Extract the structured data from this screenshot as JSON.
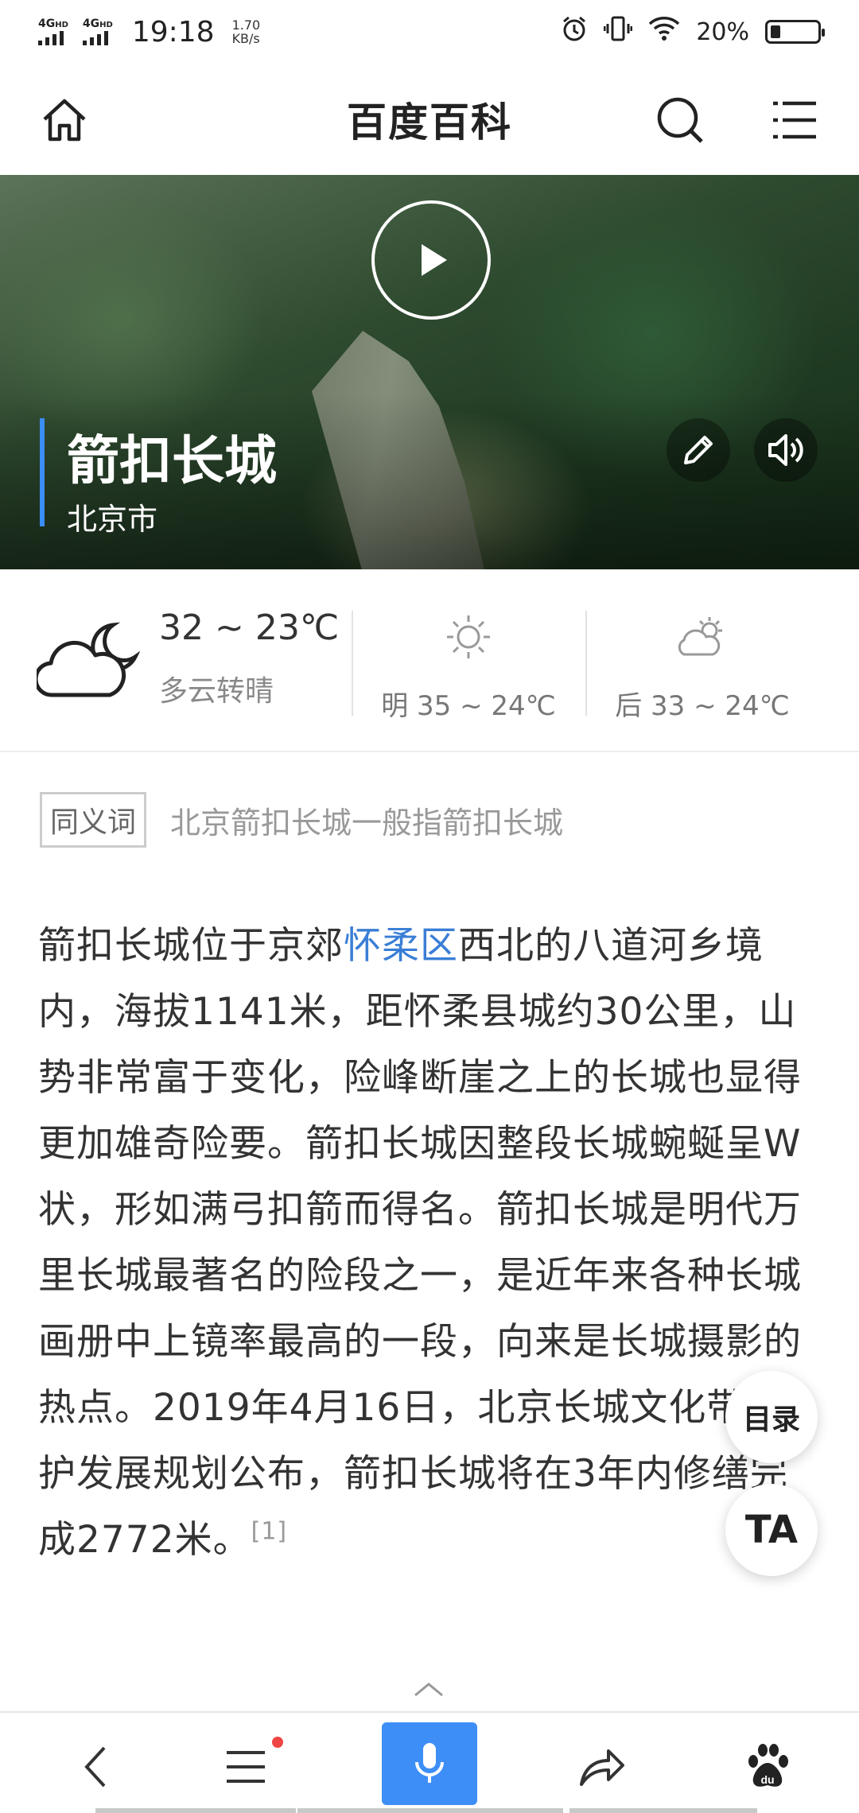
{
  "status_bar": {
    "network_1": "4G",
    "network_1_sup": "HD",
    "network_2": "4G",
    "network_2_sup": "HD",
    "time": "19:18",
    "speed_value": "1.70",
    "speed_unit": "KB/s",
    "battery_text": "20%",
    "battery_level": 0.2
  },
  "header": {
    "title": "百度百科",
    "home_icon": "home-icon",
    "search_icon": "search-icon",
    "menu_icon": "menu-list-icon"
  },
  "hero": {
    "title": "箭扣长城",
    "subtitle": "北京市",
    "accent_color": "#3a8ef6"
  },
  "weather": {
    "today": {
      "temp": "32 ~ 23℃",
      "desc": "多云转晴",
      "icon": "cloudy-night-icon"
    },
    "tomorrow": {
      "text": "明 35 ~ 24℃",
      "icon": "sun-icon"
    },
    "after": {
      "text": "后 33 ~ 24℃",
      "icon": "partly-cloudy-icon"
    }
  },
  "synonym": {
    "tag": "同义词",
    "text": "北京箭扣长城一般指箭扣长城"
  },
  "article": {
    "part1": "箭扣长城位于京郊",
    "link": "怀柔区",
    "part2": "西北的八道河乡境内，海拔1141米，距怀柔县城约30公里，山势非常富于变化，险峰断崖之上的长城也显得更加雄奇险要。箭扣长城因整段长城蜿蜒呈W 状，形如满弓扣箭而得名。箭扣长城是明代万里长城最著名的险段之一，是近年来各种长城画册中上镜率最高的一段，向来是长城摄影的热点。2019年4月16日，北京长城文化带保护发展规划公布，箭扣长城将在3年内修缮完成2772米。",
    "ref": "[1]"
  },
  "floating": {
    "toc_label": "目录",
    "ta_label": "TA"
  },
  "bottom_bar": {
    "accent_color": "#3e8ef7",
    "badge_color": "#f04545"
  }
}
